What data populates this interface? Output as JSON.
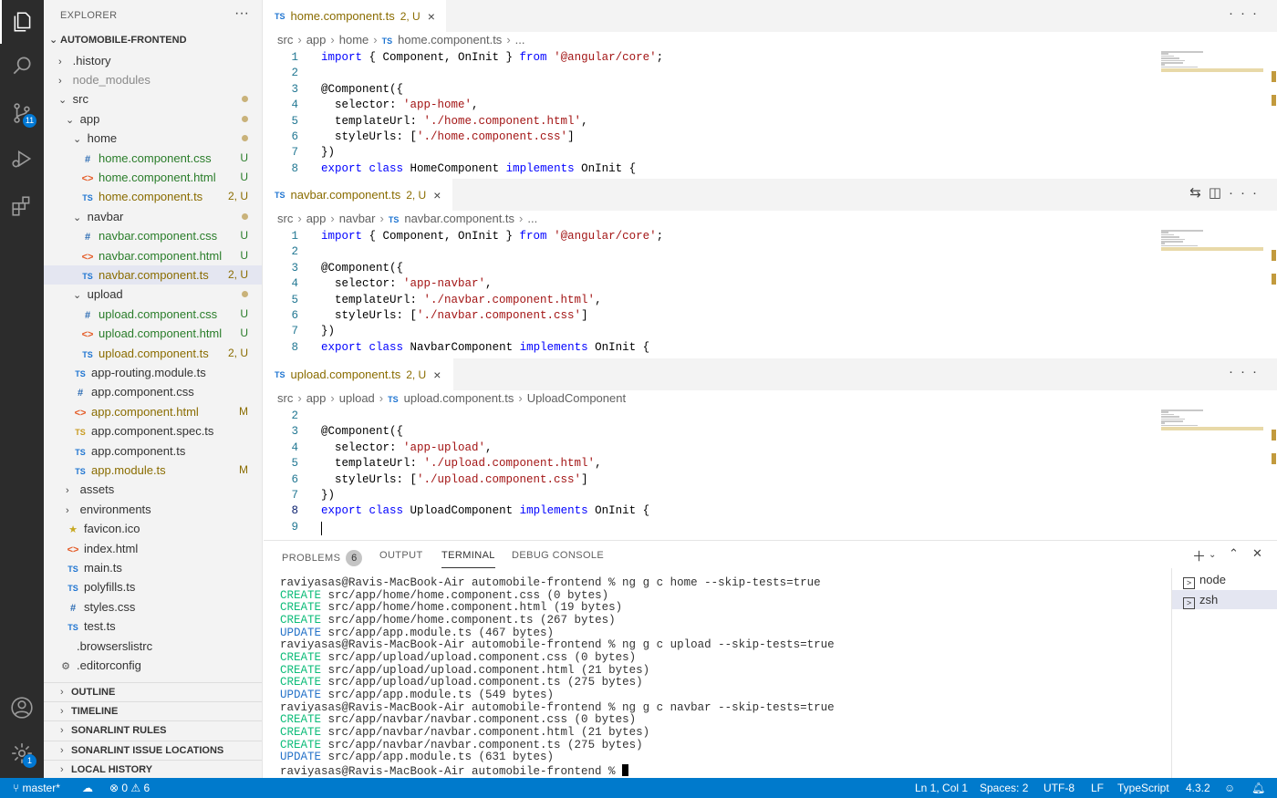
{
  "activity": {
    "scm_badge": "11",
    "settings_badge": "1"
  },
  "explorer": {
    "title": "EXPLORER",
    "more": "···",
    "root": "AUTOMOBILE-FRONTEND",
    "rows": [
      {
        "label": ".history",
        "indent": 0,
        "type": "folder-closed"
      },
      {
        "label": "node_modules",
        "indent": 0,
        "type": "folder-closed",
        "muted": true
      },
      {
        "label": "src",
        "indent": 0,
        "type": "folder-open",
        "dot": true
      },
      {
        "label": "app",
        "indent": 1,
        "type": "folder-open",
        "dot": true
      },
      {
        "label": "home",
        "indent": 2,
        "type": "folder-open",
        "dot": true
      },
      {
        "label": "home.component.css",
        "indent": 3,
        "type": "css",
        "status": "U"
      },
      {
        "label": "home.component.html",
        "indent": 3,
        "type": "html",
        "status": "U"
      },
      {
        "label": "home.component.ts",
        "indent": 3,
        "type": "ts",
        "status": "2, U"
      },
      {
        "label": "navbar",
        "indent": 2,
        "type": "folder-open",
        "dot": true
      },
      {
        "label": "navbar.component.css",
        "indent": 3,
        "type": "css",
        "status": "U"
      },
      {
        "label": "navbar.component.html",
        "indent": 3,
        "type": "html",
        "status": "U"
      },
      {
        "label": "navbar.component.ts",
        "indent": 3,
        "type": "ts",
        "status": "2, U",
        "selected": true
      },
      {
        "label": "upload",
        "indent": 2,
        "type": "folder-open",
        "dot": true
      },
      {
        "label": "upload.component.css",
        "indent": 3,
        "type": "css",
        "status": "U"
      },
      {
        "label": "upload.component.html",
        "indent": 3,
        "type": "html",
        "status": "U"
      },
      {
        "label": "upload.component.ts",
        "indent": 3,
        "type": "ts",
        "status": "2, U"
      },
      {
        "label": "app-routing.module.ts",
        "indent": 2,
        "type": "ts"
      },
      {
        "label": "app.component.css",
        "indent": 2,
        "type": "css"
      },
      {
        "label": "app.component.html",
        "indent": 2,
        "type": "html",
        "status": "M"
      },
      {
        "label": "app.component.spec.ts",
        "indent": 2,
        "type": "spec"
      },
      {
        "label": "app.component.ts",
        "indent": 2,
        "type": "ts"
      },
      {
        "label": "app.module.ts",
        "indent": 2,
        "type": "ts",
        "status": "M"
      },
      {
        "label": "assets",
        "indent": 1,
        "type": "folder-closed"
      },
      {
        "label": "environments",
        "indent": 1,
        "type": "folder-closed"
      },
      {
        "label": "favicon.ico",
        "indent": 1,
        "type": "star"
      },
      {
        "label": "index.html",
        "indent": 1,
        "type": "html"
      },
      {
        "label": "main.ts",
        "indent": 1,
        "type": "ts"
      },
      {
        "label": "polyfills.ts",
        "indent": 1,
        "type": "ts"
      },
      {
        "label": "styles.css",
        "indent": 1,
        "type": "css"
      },
      {
        "label": "test.ts",
        "indent": 1,
        "type": "ts"
      },
      {
        "label": ".browserslistrc",
        "indent": 0,
        "type": "plain"
      },
      {
        "label": ".editorconfig",
        "indent": 0,
        "type": "gear"
      }
    ],
    "sections": [
      "OUTLINE",
      "TIMELINE",
      "SONARLINT RULES",
      "SONARLINT ISSUE LOCATIONS",
      "LOCAL HISTORY"
    ]
  },
  "editors": [
    {
      "tab_icon": "TS",
      "tab": "home.component.ts",
      "tab_status": "2, U",
      "crumbs": [
        "src",
        "app",
        "home",
        "TS",
        "home.component.ts",
        "..."
      ],
      "lines": [
        {
          "n": "1",
          "html": "<span class=\"kw\">import</span> { Component, OnInit } <span class=\"kw\">from</span> <span class=\"str\">'@angular/core'</span>;"
        },
        {
          "n": "2",
          "html": ""
        },
        {
          "n": "3",
          "html": "@Component({"
        },
        {
          "n": "4",
          "html": "  selector: <span class=\"str\">'app-home'</span>,"
        },
        {
          "n": "5",
          "html": "  templateUrl: <span class=\"str\">'./home.component.html'</span>,"
        },
        {
          "n": "6",
          "html": "  styleUrls: [<span class=\"str\">'./home.component.css'</span>]"
        },
        {
          "n": "7",
          "html": "})"
        },
        {
          "n": "8",
          "html": "<span class=\"kw\">export</span> <span class=\"kw\">class</span> HomeComponent <span class=\"kw\">implements</span> OnInit {"
        }
      ]
    },
    {
      "tab_icon": "TS",
      "tab": "navbar.component.ts",
      "tab_status": "2, U",
      "crumbs": [
        "src",
        "app",
        "navbar",
        "TS",
        "navbar.component.ts",
        "..."
      ],
      "lines": [
        {
          "n": "1",
          "html": "<span class=\"kw\">import</span> { Component, OnInit } <span class=\"kw\">from</span> <span class=\"str\">'@angular/core'</span>;"
        },
        {
          "n": "2",
          "html": ""
        },
        {
          "n": "3",
          "html": "@Component({"
        },
        {
          "n": "4",
          "html": "  selector: <span class=\"str\">'app-navbar'</span>,"
        },
        {
          "n": "5",
          "html": "  templateUrl: <span class=\"str\">'./navbar.component.html'</span>,"
        },
        {
          "n": "6",
          "html": "  styleUrls: [<span class=\"str\">'./navbar.component.css'</span>]"
        },
        {
          "n": "7",
          "html": "})"
        },
        {
          "n": "8",
          "html": "<span class=\"kw\">export</span> <span class=\"kw\">class</span> NavbarComponent <span class=\"kw\">implements</span> OnInit {"
        }
      ]
    },
    {
      "tab_icon": "TS",
      "tab": "upload.component.ts",
      "tab_status": "2, U",
      "crumbs": [
        "src",
        "app",
        "upload",
        "TS",
        "upload.component.ts",
        "UploadComponent"
      ],
      "lines": [
        {
          "n": "2",
          "html": ""
        },
        {
          "n": "3",
          "html": "@Component({"
        },
        {
          "n": "4",
          "html": "  selector: <span class=\"str\">'app-upload'</span>,"
        },
        {
          "n": "5",
          "html": "  templateUrl: <span class=\"str\">'./upload.component.html'</span>,"
        },
        {
          "n": "6",
          "html": "  styleUrls: [<span class=\"str\">'./upload.component.css'</span>]"
        },
        {
          "n": "7",
          "html": "})"
        },
        {
          "n": "8",
          "html": "<span class=\"kw\">export</span> <span class=\"kw\">class</span> UploadComponent <span class=\"kw\">implements</span> OnInit {"
        },
        {
          "n": "9",
          "html": ""
        }
      ]
    }
  ],
  "panel": {
    "tabs": [
      {
        "label": "PROBLEMS",
        "badge": "6"
      },
      {
        "label": "OUTPUT"
      },
      {
        "label": "TERMINAL",
        "active": true
      },
      {
        "label": "DEBUG CONSOLE"
      }
    ],
    "terminal_lines": [
      {
        "kind": "prompt",
        "text": "raviyasas@Ravis-MacBook-Air automobile-frontend % ng g c home --skip-tests=true"
      },
      {
        "kind": "CREATE",
        "text": " src/app/home/home.component.css (0 bytes)"
      },
      {
        "kind": "CREATE",
        "text": " src/app/home/home.component.html (19 bytes)"
      },
      {
        "kind": "CREATE",
        "text": " src/app/home/home.component.ts (267 bytes)"
      },
      {
        "kind": "UPDATE",
        "text": " src/app/app.module.ts (467 bytes)"
      },
      {
        "kind": "prompt",
        "text": "raviyasas@Ravis-MacBook-Air automobile-frontend % ng g c upload --skip-tests=true"
      },
      {
        "kind": "CREATE",
        "text": " src/app/upload/upload.component.css (0 bytes)"
      },
      {
        "kind": "CREATE",
        "text": " src/app/upload/upload.component.html (21 bytes)"
      },
      {
        "kind": "CREATE",
        "text": " src/app/upload/upload.component.ts (275 bytes)"
      },
      {
        "kind": "UPDATE",
        "text": " src/app/app.module.ts (549 bytes)"
      },
      {
        "kind": "prompt",
        "text": "raviyasas@Ravis-MacBook-Air automobile-frontend % ng g c navbar --skip-tests=true"
      },
      {
        "kind": "CREATE",
        "text": " src/app/navbar/navbar.component.css (0 bytes)"
      },
      {
        "kind": "CREATE",
        "text": " src/app/navbar/navbar.component.html (21 bytes)"
      },
      {
        "kind": "CREATE",
        "text": " src/app/navbar/navbar.component.ts (275 bytes)"
      },
      {
        "kind": "UPDATE",
        "text": " src/app/app.module.ts (631 bytes)"
      },
      {
        "kind": "last",
        "text": "raviyasas@Ravis-MacBook-Air automobile-frontend % "
      }
    ],
    "terminals": [
      {
        "label": "node"
      },
      {
        "label": "zsh",
        "selected": true
      }
    ]
  },
  "status": {
    "branch": "master*",
    "errors": "0",
    "warnings": "6",
    "position": "Ln 1, Col 1",
    "spaces": "Spaces: 2",
    "encoding": "UTF-8",
    "eol": "LF",
    "language": "TypeScript",
    "version": "4.3.2"
  }
}
